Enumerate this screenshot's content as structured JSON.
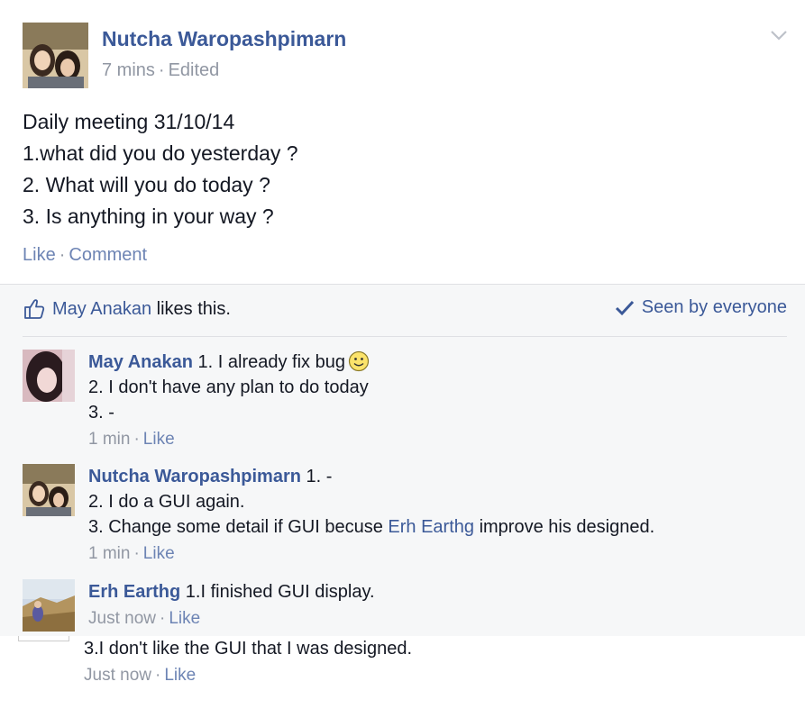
{
  "post": {
    "author": "Nutcha Waropashpimarn",
    "time": "7 mins",
    "edited": "Edited",
    "meta_sep": "·",
    "lines": [
      "Daily meeting 31/10/14",
      "1.what did you do yesterday ?",
      "2. What will you do today ?",
      "3. Is anything in your way ?"
    ],
    "like_label": "Like",
    "comment_label": "Comment",
    "action_sep": "·"
  },
  "ufi": {
    "liker": "May Anakan",
    "likes_suffix": " likes this.",
    "seen_label": "Seen by everyone"
  },
  "comments": [
    {
      "author": "May Anakan",
      "first_line": " 1. I already fix bug",
      "lines": [
        "2. I don't have any plan to do today",
        "3. -"
      ],
      "time": "1 min",
      "like": "Like",
      "sep": "·"
    },
    {
      "author": "Nutcha Waropashpimarn",
      "first_line": " 1. -",
      "line2": "2. I do a GUI again.",
      "line3_pre": "3. Change some detail if GUI becuse ",
      "line3_link": "Erh Earthg",
      "line3_post": " improve his designed.",
      "time": "1 min",
      "like": "Like",
      "sep": "·"
    },
    {
      "author": "Erh Earthg",
      "first_line": " 1.I finished GUI display.",
      "time": "Just now",
      "like": "Like",
      "sep": "·"
    }
  ],
  "cropped_comment": {
    "line": "3.I don't like the GUI that I was designed.",
    "time": "Just now",
    "like": "Like",
    "sep": "·"
  },
  "colors": {
    "link": "#3b5998",
    "muted": "#9197a3",
    "ufi_bg": "#f6f7f8"
  },
  "icons": [
    "chevron-down-icon",
    "thumbs-up-icon",
    "checkmark-icon",
    "smiley-emoji-icon"
  ]
}
